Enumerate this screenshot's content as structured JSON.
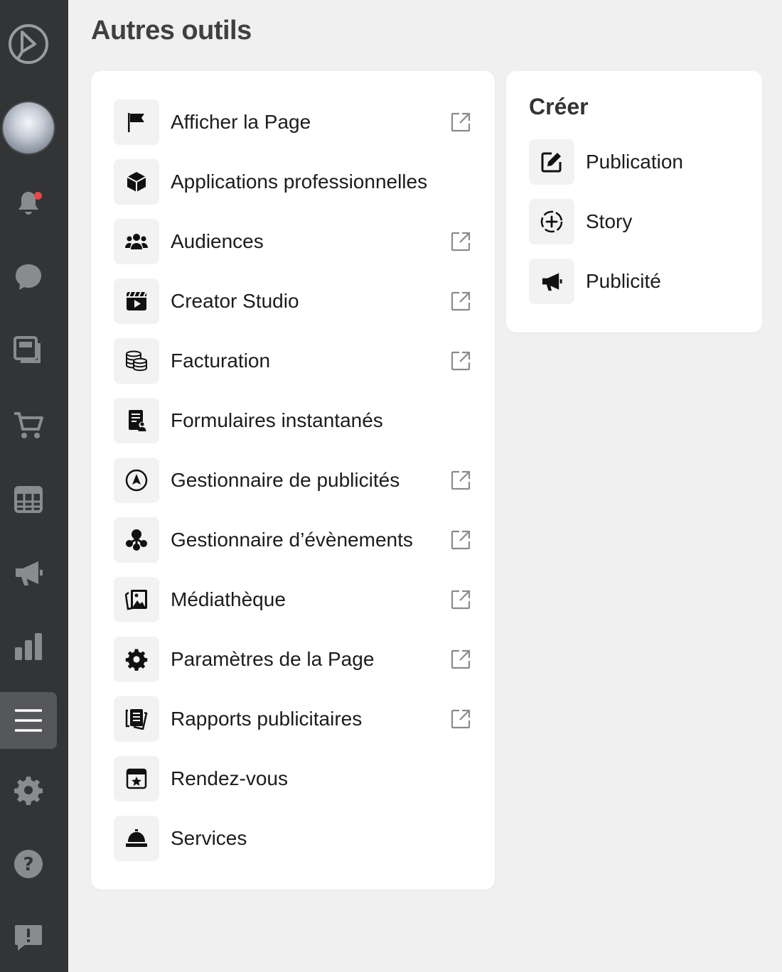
{
  "page": {
    "title": "Autres outils"
  },
  "sidebar": {
    "items": [
      {
        "icon": "meta-business-logo-icon"
      },
      {
        "icon": "profile-avatar"
      },
      {
        "icon": "bell-icon",
        "has_badge": true
      },
      {
        "icon": "chat-bubble-icon"
      },
      {
        "icon": "content-pages-icon"
      },
      {
        "icon": "shopping-cart-icon"
      },
      {
        "icon": "calendar-grid-icon"
      },
      {
        "icon": "megaphone-icon"
      },
      {
        "icon": "bar-chart-icon"
      },
      {
        "icon": "hamburger-menu-icon",
        "active": true
      },
      {
        "icon": "gear-icon"
      },
      {
        "icon": "help-icon"
      },
      {
        "icon": "feedback-icon"
      }
    ]
  },
  "tools": [
    {
      "label": "Afficher la Page",
      "icon": "flag-icon",
      "external": true
    },
    {
      "label": "Applications professionnelles",
      "icon": "cube-icon",
      "external": false
    },
    {
      "label": "Audiences",
      "icon": "people-group-icon",
      "external": true
    },
    {
      "label": "Creator Studio",
      "icon": "clapperboard-icon",
      "external": true
    },
    {
      "label": "Facturation",
      "icon": "coins-stack-icon",
      "external": true
    },
    {
      "label": "Formulaires instantanés",
      "icon": "form-person-icon",
      "external": false
    },
    {
      "label": "Gestionnaire de publicités",
      "icon": "compass-arrow-icon",
      "external": true
    },
    {
      "label": "Gestionnaire d’évènements",
      "icon": "nodes-icon",
      "external": true
    },
    {
      "label": "Médiathèque",
      "icon": "image-library-icon",
      "external": true
    },
    {
      "label": "Paramètres de la Page",
      "icon": "gear-icon",
      "external": true
    },
    {
      "label": "Rapports publicitaires",
      "icon": "report-pages-icon",
      "external": true
    },
    {
      "label": "Rendez-vous",
      "icon": "calendar-star-icon",
      "external": false
    },
    {
      "label": "Services",
      "icon": "service-bell-icon",
      "external": false
    }
  ],
  "create": {
    "title": "Créer",
    "items": [
      {
        "label": "Publication",
        "icon": "compose-icon"
      },
      {
        "label": "Story",
        "icon": "story-add-icon"
      },
      {
        "label": "Publicité",
        "icon": "megaphone-icon"
      }
    ]
  },
  "colors": {
    "rail": "#333436",
    "rail_active": "#56575a",
    "rail_icon": "#8a8b8d",
    "badge": "#e4484a",
    "background": "#f0f0f0",
    "card": "#ffffff"
  }
}
